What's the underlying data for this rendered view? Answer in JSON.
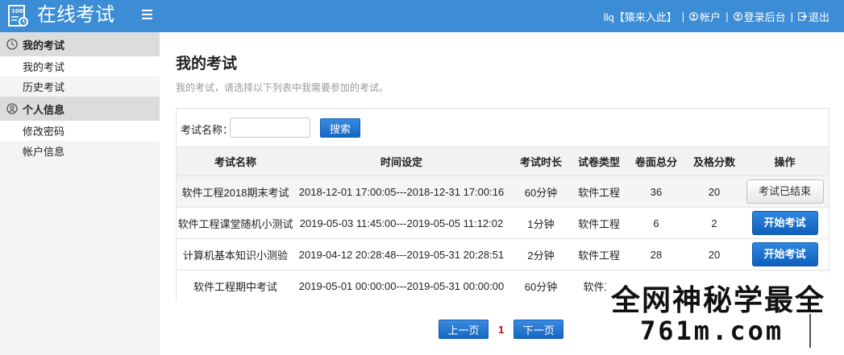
{
  "header": {
    "title": "在线考试",
    "user_label": "llq【猿来入此】",
    "account_label": "帐户",
    "admin_label": "登录后台",
    "logout_label": "退出",
    "separator": "|"
  },
  "sidebar": {
    "groups": [
      {
        "title": "我的考试",
        "items": [
          "我的考试",
          "历史考试"
        ]
      },
      {
        "title": "个人信息",
        "items": [
          "修改密码",
          "帐户信息"
        ]
      }
    ]
  },
  "main": {
    "title": "我的考试",
    "description": "我的考试，请选择以下列表中我需要参加的考试。",
    "search": {
      "label": "考试名称：",
      "value": "",
      "button": "搜索"
    },
    "table": {
      "headers": [
        "考试名称",
        "时间设定",
        "考试时长",
        "试卷类型",
        "卷面总分",
        "及格分数",
        "操作"
      ],
      "rows": [
        {
          "name": "软件工程2018期末考试",
          "time": "2018-12-01 17:00:05---2018-12-31 17:00:16",
          "duration": "60分钟",
          "type": "软件工程",
          "total": "36",
          "pass": "20",
          "action": "考试已结束"
        },
        {
          "name": "软件工程课堂随机小测试",
          "time": "2019-05-03 11:45:00---2019-05-05 11:12:02",
          "duration": "1分钟",
          "type": "软件工程",
          "total": "6",
          "pass": "2",
          "action": "开始考试"
        },
        {
          "name": "计算机基本知识小测验",
          "time": "2019-04-12 20:28:48---2019-05-31 20:28:51",
          "duration": "2分钟",
          "type": "软件工程",
          "total": "28",
          "pass": "20",
          "action": "开始考试"
        },
        {
          "name": "软件工程期中考试",
          "time": "2019-05-01 00:00:00---2019-05-31 00:00:00",
          "duration": "60分钟",
          "type": "软件工",
          "total": "",
          "pass": "",
          "action": ""
        }
      ]
    },
    "pager": {
      "prev": "上一页",
      "current": "1",
      "next": "下一页"
    }
  },
  "watermark": {
    "line1": "全网神秘学最全",
    "line2": "761m.com"
  },
  "colors": {
    "header_bg": "#3c8dd6",
    "primary_button": "#1568c2",
    "current_page": "#cc0000"
  }
}
